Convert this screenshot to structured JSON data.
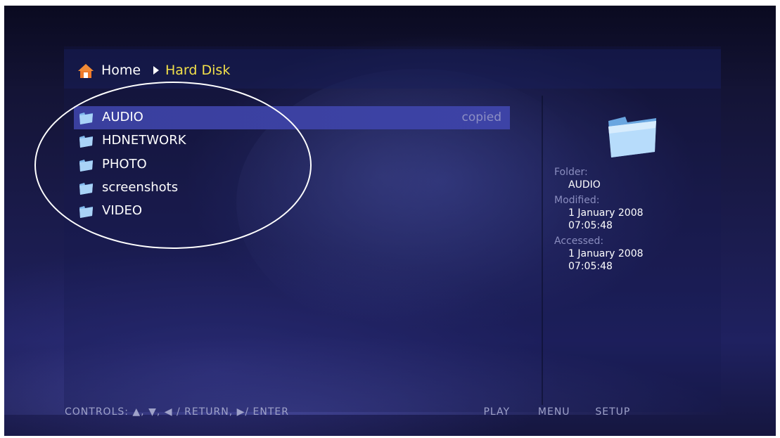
{
  "breadcrumb": {
    "home": "Home",
    "current": "Hard Disk"
  },
  "files": [
    {
      "label": "AUDIO",
      "status": "copied",
      "selected": true
    },
    {
      "label": "HDNETWORK",
      "status": "",
      "selected": false
    },
    {
      "label": "PHOTO",
      "status": "",
      "selected": false
    },
    {
      "label": "screenshots",
      "status": "",
      "selected": false
    },
    {
      "label": "VIDEO",
      "status": "",
      "selected": false
    }
  ],
  "info": {
    "folder_label": "Folder:",
    "folder_value": "AUDIO",
    "modified_label": "Modified:",
    "modified_date": "1 January 2008",
    "modified_time": "07:05:48",
    "accessed_label": "Accessed:",
    "accessed_date": "1 January 2008",
    "accessed_time": "07:05:48"
  },
  "footer": {
    "controls": "CONTROLS:  ▲, ▼, ◀ / RETURN, ▶/ ENTER",
    "play": "PLAY",
    "menu": "MENU",
    "setup": "SETUP"
  },
  "colors": {
    "breadcrumb_current": "#f2e04a",
    "selection": "#3a3f9e"
  }
}
